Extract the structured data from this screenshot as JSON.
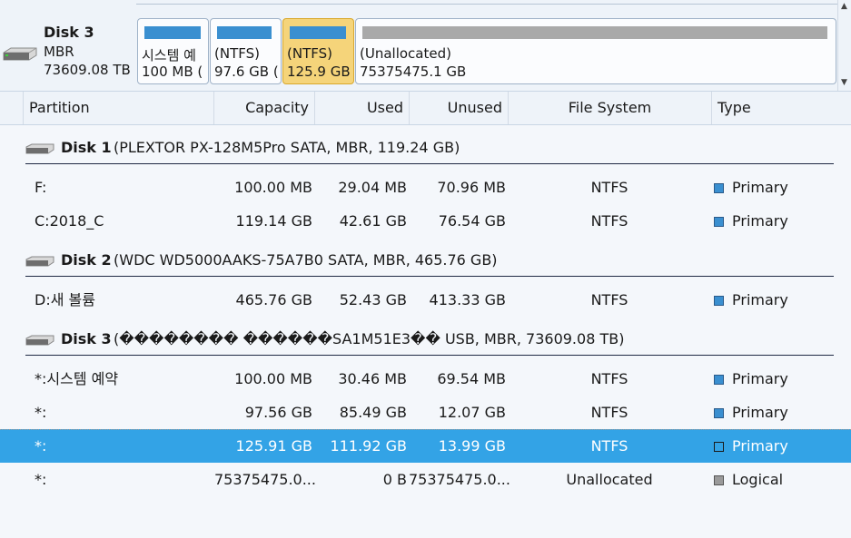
{
  "disk_map": {
    "name": "Disk 3",
    "scheme": "MBR",
    "size": "73609.08 TB",
    "blocks": [
      {
        "line1": "시스템 예",
        "line2": "100 MB (",
        "bar_color": "#3a8fd0"
      },
      {
        "line1": "(NTFS)",
        "line2": "97.6 GB (",
        "bar_color": "#3a8fd0"
      },
      {
        "line1": "(NTFS)",
        "line2": "125.9 GB",
        "bar_color": "#3a8fd0",
        "selected": true
      },
      {
        "line1": "(Unallocated)",
        "line2": "75375475.1 GB",
        "bar_color": "#a9a9a9"
      }
    ]
  },
  "columns": {
    "partition": "Partition",
    "capacity": "Capacity",
    "used": "Used",
    "unused": "Unused",
    "file_system": "File System",
    "type": "Type"
  },
  "disks": [
    {
      "name": "Disk 1",
      "desc": "(PLEXTOR PX-128M5Pro SATA, MBR, 119.24 GB)",
      "partitions": [
        {
          "partition": "F:",
          "capacity": "100.00 MB",
          "used": "29.04 MB",
          "unused": "70.96 MB",
          "fs": "NTFS",
          "type": "Primary"
        },
        {
          "partition": "C:2018_C",
          "capacity": "119.14 GB",
          "used": "42.61 GB",
          "unused": "76.54 GB",
          "fs": "NTFS",
          "type": "Primary"
        }
      ]
    },
    {
      "name": "Disk 2",
      "desc": "(WDC WD5000AAKS-75A7B0 SATA, MBR, 465.76 GB)",
      "partitions": [
        {
          "partition": "D:새 볼륨",
          "capacity": "465.76 GB",
          "used": "52.43 GB",
          "unused": "413.33 GB",
          "fs": "NTFS",
          "type": "Primary"
        }
      ]
    },
    {
      "name": "Disk 3",
      "desc": "(�������� ������SA1M51E3�� USB, MBR, 73609.08 TB)",
      "partitions": [
        {
          "partition": "*:시스템 예약",
          "capacity": "100.00 MB",
          "used": "30.46 MB",
          "unused": "69.54 MB",
          "fs": "NTFS",
          "type": "Primary"
        },
        {
          "partition": "*:",
          "capacity": "97.56 GB",
          "used": "85.49 GB",
          "unused": "12.07 GB",
          "fs": "NTFS",
          "type": "Primary"
        },
        {
          "partition": "*:",
          "capacity": "125.91 GB",
          "used": "111.92 GB",
          "unused": "13.99 GB",
          "fs": "NTFS",
          "type": "Primary",
          "selected": true
        },
        {
          "partition": "*:",
          "capacity": "75375475.0...",
          "used": "0 B",
          "unused": "75375475.0...",
          "fs": "Unallocated",
          "type": "Logical"
        }
      ]
    }
  ],
  "icons": {
    "disk": "hard-disk-icon",
    "scroll_up": "scroll-up-arrow-icon",
    "scroll_down": "scroll-down-arrow-icon"
  },
  "colors": {
    "accent": "#3a8fd0",
    "selection": "#33a3e6",
    "selected_block": "#f5d47a",
    "unallocated": "#a9a9a9"
  }
}
